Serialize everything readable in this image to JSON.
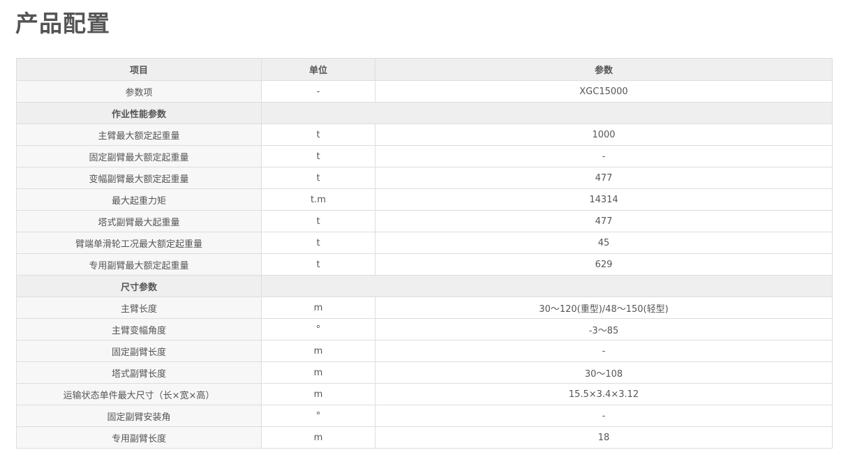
{
  "page_title": "产品配置",
  "table": {
    "headers": [
      "项目",
      "单位",
      "参数"
    ],
    "rows": [
      {
        "type": "row",
        "item": "参数项",
        "unit": "-",
        "value": "XGC15000"
      },
      {
        "type": "section",
        "item": "作业性能参数"
      },
      {
        "type": "row",
        "item": "主臂最大额定起重量",
        "unit": "t",
        "value": "1000"
      },
      {
        "type": "row",
        "item": "固定副臂最大额定起重量",
        "unit": "t",
        "value": "-"
      },
      {
        "type": "row",
        "item": "变幅副臂最大额定起重量",
        "unit": "t",
        "value": "477"
      },
      {
        "type": "row",
        "item": "最大起重力矩",
        "unit": "t.m",
        "value": "14314"
      },
      {
        "type": "row",
        "item": "塔式副臂最大起重量",
        "unit": "t",
        "value": "477"
      },
      {
        "type": "row",
        "item": "臂端单滑轮工况最大额定起重量",
        "unit": "t",
        "value": "45"
      },
      {
        "type": "row",
        "item": "专用副臂最大额定起重量",
        "unit": "t",
        "value": "629"
      },
      {
        "type": "section",
        "item": "尺寸参数"
      },
      {
        "type": "row",
        "item": "主臂长度",
        "unit": "m",
        "value": "30～120(重型)/48～150(轻型)"
      },
      {
        "type": "row",
        "item": "主臂变幅角度",
        "unit": "°",
        "value": "-3～85"
      },
      {
        "type": "row",
        "item": "固定副臂长度",
        "unit": "m",
        "value": "-"
      },
      {
        "type": "row",
        "item": "塔式副臂长度",
        "unit": "m",
        "value": "30～108"
      },
      {
        "type": "row",
        "item": "运输状态单件最大尺寸（长×宽×高）",
        "unit": "m",
        "value": "15.5×3.4×3.12"
      },
      {
        "type": "row",
        "item": "固定副臂安装角",
        "unit": "°",
        "value": "-"
      },
      {
        "type": "row",
        "item": "专用副臂长度",
        "unit": "m",
        "value": "18"
      }
    ]
  }
}
